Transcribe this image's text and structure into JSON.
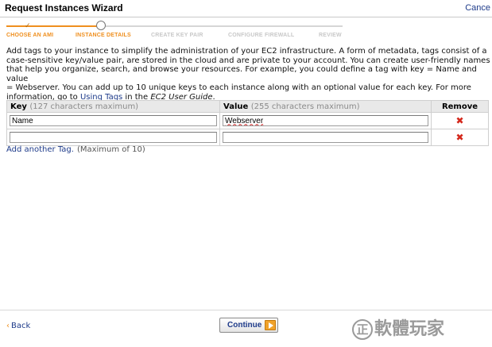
{
  "window": {
    "title": "Request Instances Wizard",
    "cancel_label": "Cance"
  },
  "steps": [
    {
      "label": "CHOOSE AN AMI",
      "state": "done"
    },
    {
      "label": "INSTANCE DETAILS",
      "state": "active"
    },
    {
      "label": "CREATE KEY PAIR",
      "state": "todo"
    },
    {
      "label": "CONFIGURE FIREWALL",
      "state": "todo"
    },
    {
      "label": "REVIEW",
      "state": "todo"
    }
  ],
  "description": {
    "line1": "Add tags to your instance to simplify the administration of your EC2 infrastructure. A form of metadata, tags consist of a",
    "line2": "case-sensitive key/value pair, are stored in the cloud and are private to your account. You can create user-friendly names",
    "line3": "that help you organize, search, and browse your resources. For example, you could define a tag with key = Name and value",
    "line4": "= Webserver. You can add up to 10 unique keys to each instance along with an optional value for each key. For more",
    "line5_prefix": "information, go to ",
    "link_text": "Using Tags",
    "line5_mid": " in the ",
    "guide_text": "EC2 User Guide",
    "line5_suffix": "."
  },
  "table": {
    "key_header": "Key",
    "key_hint": "(127 characters maximum)",
    "value_header": "Value",
    "value_hint": "(255 characters maximum)",
    "remove_header": "Remove",
    "rows": [
      {
        "key": "Name",
        "value": "Webserver"
      },
      {
        "key": "",
        "value": ""
      }
    ]
  },
  "add_tag": {
    "link": "Add another Tag.",
    "max": "(Maximum of 10)"
  },
  "footer": {
    "back_label": "Back",
    "continue_label": "Continue"
  },
  "watermark": {
    "circle": "正",
    "text": "軟體玩家"
  },
  "colors": {
    "accent": "#ef8f1e",
    "link": "#1e3b8a",
    "remove": "#d4281c"
  }
}
